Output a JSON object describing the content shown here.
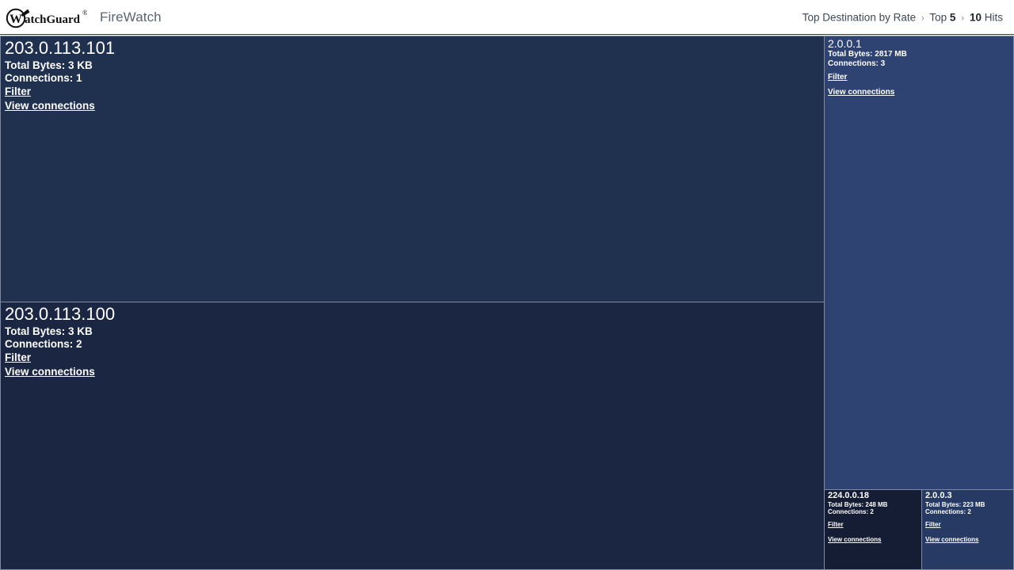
{
  "header": {
    "logo_icon": "watchguard-logo-icon",
    "logo_text": "atchGuard",
    "logo_mark_letter": "W",
    "product_title": "FireWatch",
    "breadcrumb": {
      "part1": "Top Destination by Rate",
      "sep1": "›",
      "part2_text": "Top ",
      "part2_value": "5",
      "sep2": "›",
      "part3_value": "10",
      "part3_text": " Hits"
    }
  },
  "treemap": {
    "labels": {
      "total_bytes_prefix": "Total Bytes: ",
      "connections_prefix": "Connections: ",
      "filter": "Filter",
      "view_connections": "View connections"
    },
    "tiles": [
      {
        "id": "203-0-113-101",
        "title": "203.0.113.101",
        "total_bytes": "Total Bytes: 3 KB",
        "connections": "Connections: 1",
        "filter": "Filter",
        "view_connections": "View connections",
        "color": "#20304f"
      },
      {
        "id": "203-0-113-100",
        "title": "203.0.113.100",
        "total_bytes": "Total Bytes: 3 KB",
        "connections": "Connections: 2",
        "filter": "Filter",
        "view_connections": "View connections",
        "color": "#1b2742"
      },
      {
        "id": "2-0-0-1",
        "title": "2.0.0.1",
        "total_bytes": "Total Bytes: 2817 MB",
        "connections": "Connections: 3",
        "filter": "Filter",
        "view_connections": "View connections",
        "color": "#2e4372"
      },
      {
        "id": "224-0-0-18",
        "title": "224.0.0.18",
        "total_bytes": "Total Bytes: 248 MB",
        "connections": "Connections: 2",
        "filter": "Filter",
        "view_connections": "View connections",
        "color": "#141d33"
      },
      {
        "id": "2-0-0-3",
        "title": "2.0.0.3",
        "total_bytes": "Total Bytes: 223 MB",
        "connections": "Connections: 2",
        "filter": "Filter",
        "view_connections": "View connections",
        "color": "#263a63"
      }
    ]
  }
}
